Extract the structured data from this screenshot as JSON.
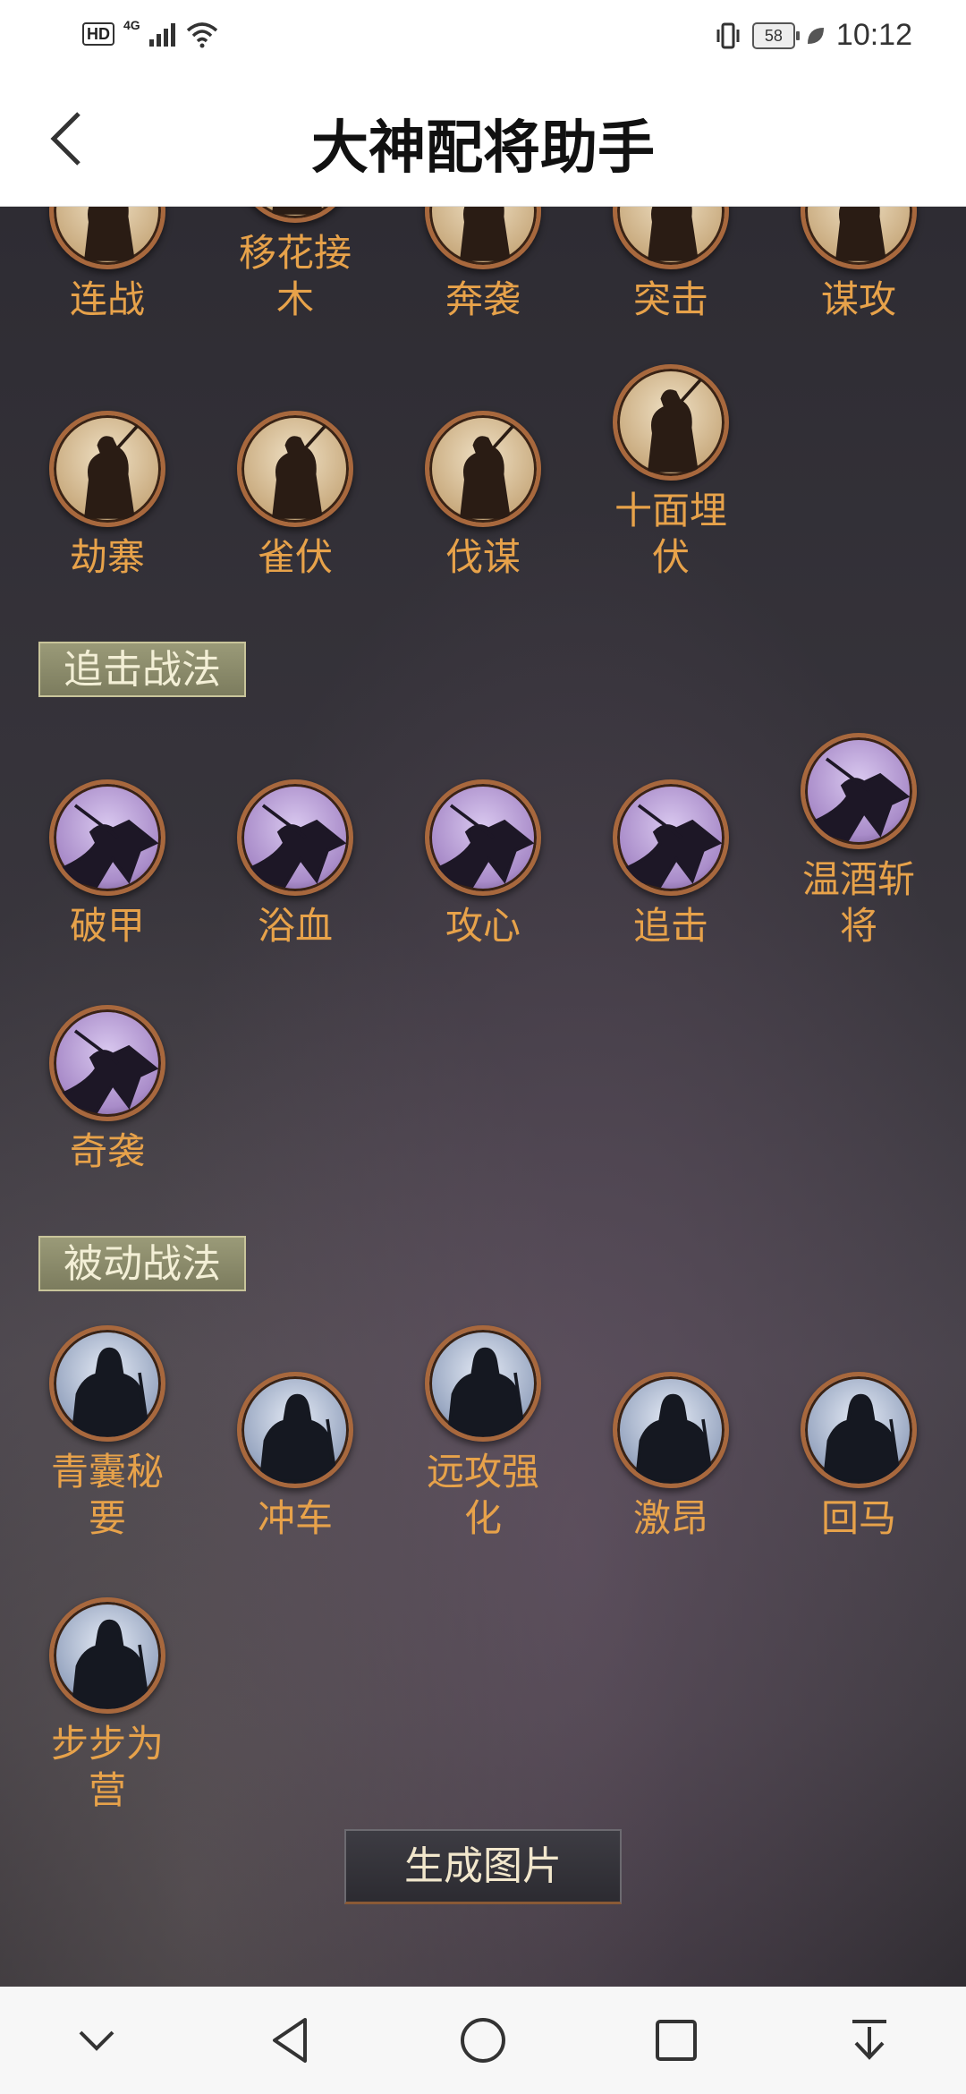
{
  "status_bar": {
    "hd": "HD",
    "network": "4G",
    "battery": "58",
    "time": "10:12"
  },
  "header": {
    "title": "大神配将助手",
    "back_icon": "chevron-left-icon"
  },
  "sections": {
    "zhuiji": "追击战法",
    "beidong": "被动战法"
  },
  "tactics": {
    "row0": [
      "连战",
      "移花接木",
      "奔袭",
      "突击",
      "谋攻"
    ],
    "row1": [
      "劫寨",
      "雀伏",
      "伐谋",
      "十面埋伏"
    ],
    "zhuiji_row0": [
      "破甲",
      "浴血",
      "攻心",
      "追击",
      "温酒斩将"
    ],
    "zhuiji_row1": [
      "奇袭"
    ],
    "beidong_row0": [
      "青囊秘要",
      "冲车",
      "远攻强化",
      "激昂",
      "回马"
    ],
    "beidong_row1": [
      "步步为营"
    ]
  },
  "generate_button": "生成图片",
  "nav_bar": [
    "chevron-down-icon",
    "back-triangle-icon",
    "home-circle-icon",
    "recents-square-icon",
    "download-arrow-icon"
  ]
}
